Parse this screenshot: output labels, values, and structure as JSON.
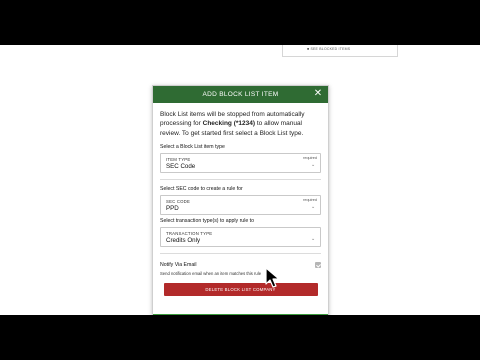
{
  "behind_card": {
    "link_label": "■ SEE BLOCKED ITEMS"
  },
  "modal": {
    "title": "ADD BLOCK LIST ITEM",
    "close_icon": "close-icon",
    "intro_pre": "Block List items will be stopped from automatically processing for ",
    "intro_account": "Checking (*1234)",
    "intro_post": " to allow manual review. To get started first select a Block List type.",
    "item_type": {
      "section_label": "Select a Block List item type",
      "caption": "ITEM TYPE",
      "value": "SEC Code",
      "required": "required"
    },
    "sec_code": {
      "section_label": "Select SEC code to create a rule for",
      "caption": "SEC CODE",
      "value": "PPD",
      "required": "required"
    },
    "transaction_type": {
      "section_label": "Select transaction type(s) to apply rule to",
      "caption": "TRANSACTION TYPE",
      "value": "Credits Only"
    },
    "notify": {
      "label": "Notify Via Email",
      "help": "Send notification email when an item matches this rule",
      "checked": true
    },
    "delete_button": "DELETE BLOCK LIST COMPANY"
  },
  "colors": {
    "header": "#2f6b33",
    "delete": "#b22a2a",
    "footer": "#3b9a3d"
  }
}
